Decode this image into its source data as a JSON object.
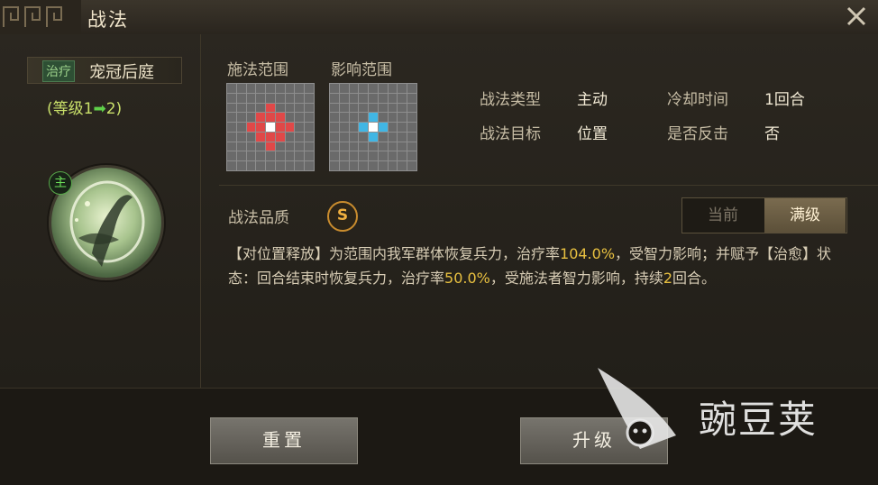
{
  "window": {
    "title": "战法"
  },
  "skill": {
    "tag": "治疗",
    "name": "宠冠后庭",
    "level_prefix": "(等级1",
    "level_arrow": "➡",
    "level_suffix": "2)",
    "main_badge": "主"
  },
  "range": {
    "cast_label": "施法范围",
    "effect_label": "影响范围"
  },
  "attributes": {
    "type_label": "战法类型",
    "type_value": "主动",
    "cooldown_label": "冷却时间",
    "cooldown_value": "1回合",
    "target_label": "战法目标",
    "target_value": "位置",
    "counter_label": "是否反击",
    "counter_value": "否"
  },
  "quality": {
    "label": "战法品质",
    "grade": "S"
  },
  "view_toggle": {
    "current": "当前",
    "max": "满级",
    "selected": "满级"
  },
  "description": {
    "p1": "【对位置释放】为范围内我军群体恢复兵力，治疗率",
    "v1": "104.0%",
    "p2": "，受智力影响；并赋予【治愈】状态：回合结束时恢复兵力，治疗率",
    "v2": "50.0%",
    "p3": "，受施法者智力影响，持续",
    "v3": "2",
    "p4": "回合。"
  },
  "buttons": {
    "reset": "重置",
    "upgrade": "升级"
  },
  "watermark": {
    "text": "豌豆荚"
  },
  "colors": {
    "cast_cells": "#e04848",
    "effect_cells": "#41b6e4",
    "center_cell": "#ffffff",
    "highlight": "#e8c040"
  }
}
